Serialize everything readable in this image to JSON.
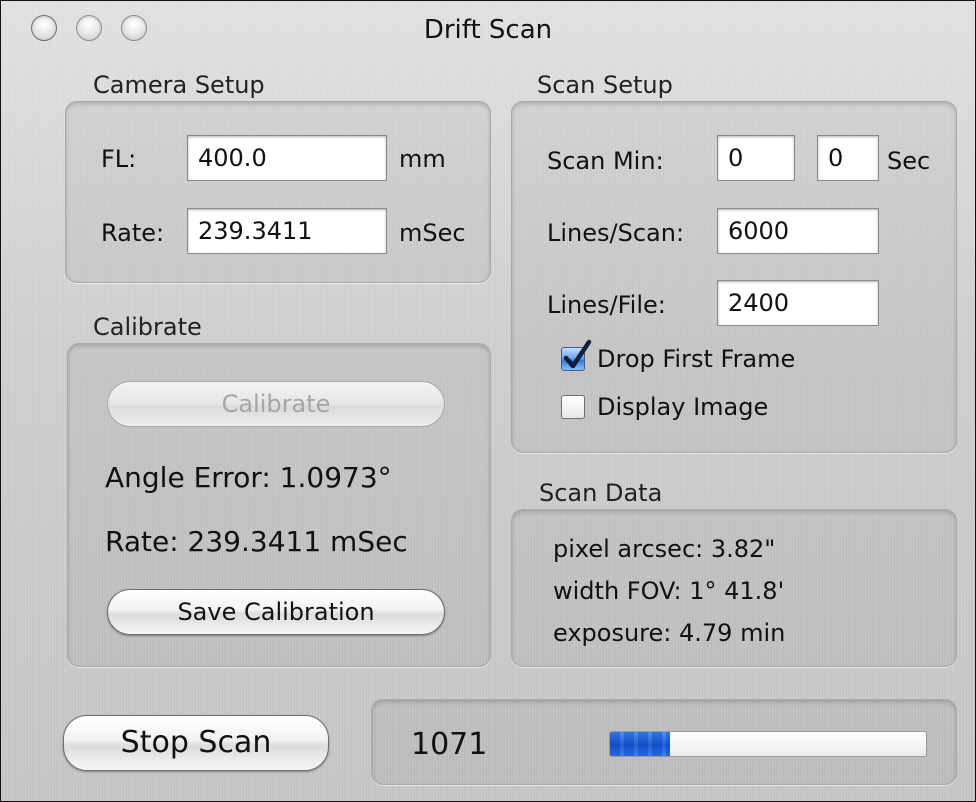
{
  "window": {
    "title": "Drift Scan"
  },
  "camera_setup": {
    "title": "Camera Setup",
    "fl_label": "FL:",
    "fl_value": "400.0",
    "fl_unit": "mm",
    "rate_label": "Rate:",
    "rate_value": "239.3411",
    "rate_unit": "mSec"
  },
  "calibrate": {
    "title": "Calibrate",
    "button_label": "Calibrate",
    "angle_error": "Angle Error: 1.0973°",
    "rate": "Rate: 239.3411 mSec",
    "save_button_label": "Save Calibration"
  },
  "scan_setup": {
    "title": "Scan Setup",
    "scan_min_label": "Scan Min:",
    "scan_min_value": "0",
    "scan_sec_value": "0",
    "sec_unit": "Sec",
    "lines_scan_label": "Lines/Scan:",
    "lines_scan_value": "6000",
    "lines_file_label": "Lines/File:",
    "lines_file_value": "2400",
    "drop_first_frame_label": "Drop First Frame",
    "drop_first_frame_checked": true,
    "display_image_label": "Display Image",
    "display_image_checked": false
  },
  "scan_data": {
    "title": "Scan Data",
    "pixel_arcsec": "pixel arcsec: 3.82\"",
    "width_fov": "width FOV: 1° 41.8'",
    "exposure": "exposure: 4.79 min"
  },
  "footer": {
    "stop_button_label": "Stop Scan",
    "count": "1071",
    "progress_fraction": 0.19
  }
}
